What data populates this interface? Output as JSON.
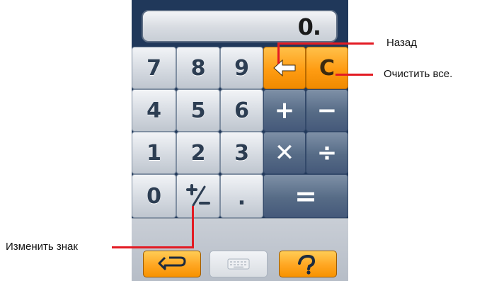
{
  "display": {
    "value": "0."
  },
  "keys": {
    "seven": "7",
    "eight": "8",
    "nine": "9",
    "four": "4",
    "five": "5",
    "six": "6",
    "one": "1",
    "two": "2",
    "three": "3",
    "zero": "0",
    "dot": ".",
    "clear": "C",
    "plus": "+",
    "minus": "−",
    "multiply": "✕",
    "divide": "÷",
    "equals": "="
  },
  "icons": {
    "backspace": "arrow-left-icon",
    "sign": "plus-minus-icon",
    "return": "return-arrow-icon",
    "keyboard": "keyboard-icon",
    "help": "help-question-icon"
  },
  "callouts": {
    "backspace": "Назад",
    "clear": "Очистить все.",
    "sign": "Изменить знак"
  },
  "colors": {
    "panel": "#20385a",
    "light_key": "#d5dae1",
    "dark_key": "#566b86",
    "orange_key": "#ff9c12",
    "callout_line": "#e31b23"
  }
}
